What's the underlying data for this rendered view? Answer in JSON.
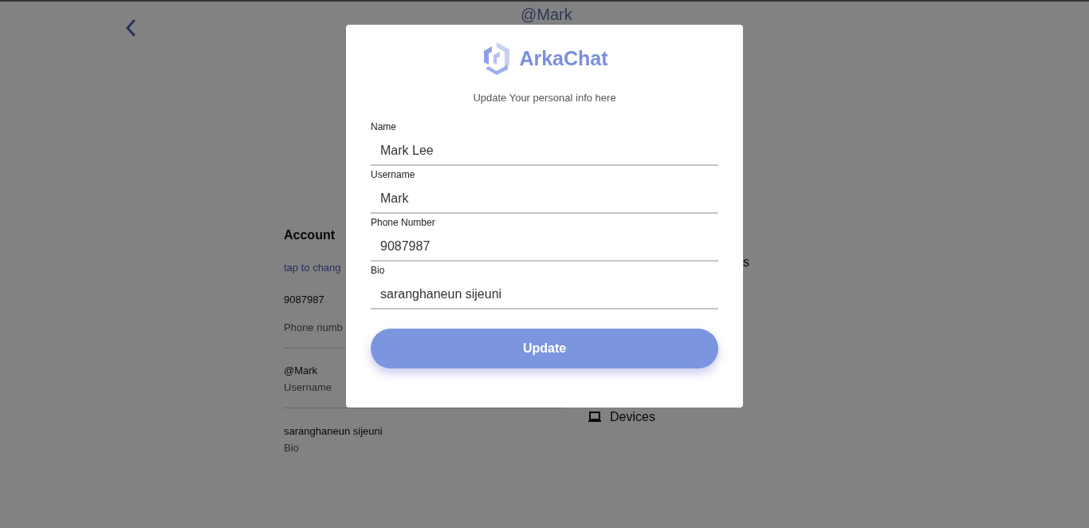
{
  "page": {
    "handle": "@Mark",
    "account": {
      "title": "Account",
      "photo_hint": "tap to chang",
      "phone": "9087987",
      "phone_label": "Phone numb",
      "username": "@Mark",
      "username_label": "Username",
      "bio": "saranghaneun sijeuni",
      "bio_label": "Bio"
    },
    "settings": [
      {
        "label": "s",
        "kind": "cut"
      },
      {
        "label": "Devices",
        "kind": "devices"
      }
    ]
  },
  "dialog": {
    "brand": "ArkaChat",
    "subtitle": "Update Your personal info here",
    "fields": [
      {
        "label": "Name",
        "value": "Mark Lee"
      },
      {
        "label": "Username",
        "value": "Mark"
      },
      {
        "label": "Phone Number",
        "value": "9087987"
      },
      {
        "label": "Bio",
        "value": "saranghaneun sijeuni"
      }
    ],
    "button": "Update"
  }
}
